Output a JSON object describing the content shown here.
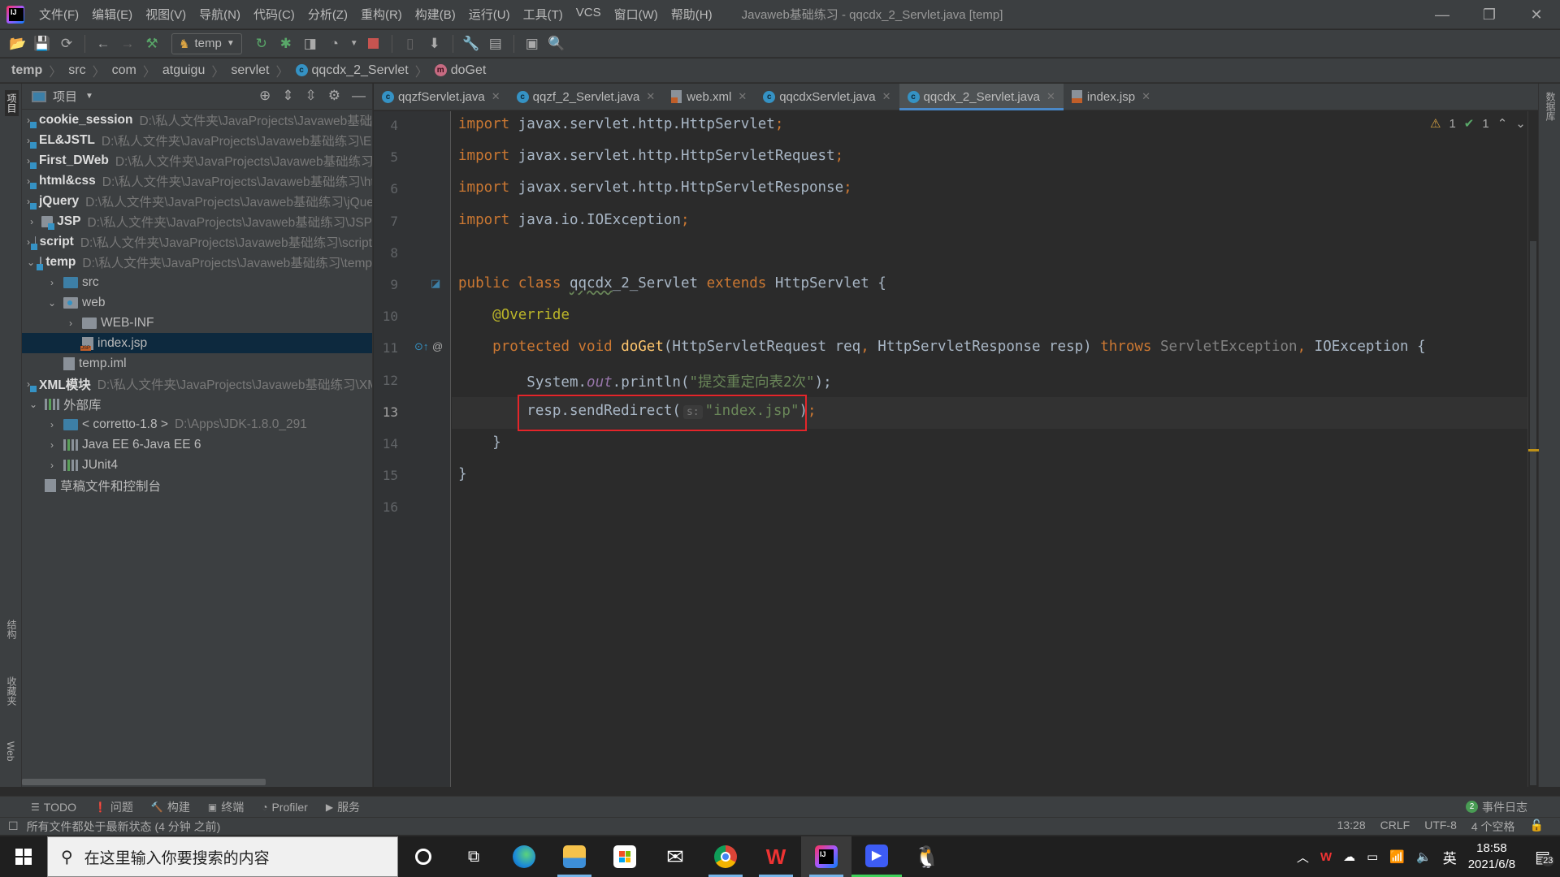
{
  "window": {
    "title": "Javaweb基础练习 - qqcdx_2_Servlet.java [temp]",
    "menu": [
      "文件(F)",
      "编辑(E)",
      "视图(V)",
      "导航(N)",
      "代码(C)",
      "分析(Z)",
      "重构(R)",
      "构建(B)",
      "运行(U)",
      "工具(T)",
      "VCS",
      "窗口(W)",
      "帮助(H)"
    ],
    "controls": {
      "minimize": "—",
      "restore": "❐",
      "close": "✕"
    }
  },
  "toolbar": {
    "run_config": "temp",
    "icons": [
      "open-icon",
      "save-icon",
      "sync-icon",
      "back-icon",
      "forward-icon",
      "build-icon",
      "run-config",
      "rerun-icon",
      "debug-icon",
      "coverage-icon",
      "profile-icon",
      "stop-icon",
      "device-icon",
      "update-icon",
      "settings-icon",
      "project-structure-icon",
      "terminal-icon",
      "search-icon"
    ]
  },
  "breadcrumb": [
    {
      "label": "temp",
      "bold": true
    },
    {
      "label": "src"
    },
    {
      "label": "com"
    },
    {
      "label": "atguigu"
    },
    {
      "label": "servlet"
    },
    {
      "label": "qqcdx_2_Servlet",
      "icon": "class-icon",
      "glyph": "c"
    },
    {
      "label": "doGet",
      "icon": "method-icon",
      "glyph": "m"
    }
  ],
  "left_strip": {
    "project": "项目",
    "structure": "结构",
    "favorites": "收藏夹",
    "web": "Web"
  },
  "right_strip": {
    "database": "数据库"
  },
  "project_panel": {
    "title": "项目",
    "tree": [
      {
        "depth": 0,
        "chev": "›",
        "icon": "module",
        "name": "cookie_session",
        "bold": true,
        "path": "D:\\私人文件夹\\JavaProjects\\Javaweb基础练习\\cookie_session"
      },
      {
        "depth": 0,
        "chev": "›",
        "icon": "module",
        "name": "EL&JSTL",
        "bold": true,
        "path": "D:\\私人文件夹\\JavaProjects\\Javaweb基础练习\\EL&JSTL"
      },
      {
        "depth": 0,
        "chev": "›",
        "icon": "module",
        "name": "First_DWeb",
        "bold": true,
        "path": "D:\\私人文件夹\\JavaProjects\\Javaweb基础练习\\First_DWeb"
      },
      {
        "depth": 0,
        "chev": "›",
        "icon": "module",
        "name": "html&css",
        "bold": true,
        "path": "D:\\私人文件夹\\JavaProjects\\Javaweb基础练习\\html&css"
      },
      {
        "depth": 0,
        "chev": "›",
        "icon": "module",
        "name": "jQuery",
        "bold": true,
        "path": "D:\\私人文件夹\\JavaProjects\\Javaweb基础练习\\jQuery"
      },
      {
        "depth": 0,
        "chev": "›",
        "icon": "module",
        "name": "JSP",
        "bold": true,
        "path": "D:\\私人文件夹\\JavaProjects\\Javaweb基础练习\\JSP"
      },
      {
        "depth": 0,
        "chev": "›",
        "icon": "module",
        "name": "script",
        "bold": true,
        "path": "D:\\私人文件夹\\JavaProjects\\Javaweb基础练习\\script"
      },
      {
        "depth": 0,
        "chev": "⌄",
        "icon": "module",
        "name": "temp",
        "bold": true,
        "path": "D:\\私人文件夹\\JavaProjects\\Javaweb基础练习\\temp"
      },
      {
        "depth": 1,
        "chev": "›",
        "icon": "src",
        "name": "src"
      },
      {
        "depth": 1,
        "chev": "⌄",
        "icon": "web",
        "name": "web"
      },
      {
        "depth": 2,
        "chev": "›",
        "icon": "folder",
        "name": "WEB-INF"
      },
      {
        "depth": 2,
        "chev": "",
        "icon": "jsp",
        "name": "index.jsp",
        "selected": true
      },
      {
        "depth": 1,
        "chev": "",
        "icon": "iml",
        "name": "temp.iml"
      },
      {
        "depth": 0,
        "chev": "›",
        "icon": "module",
        "name": "XML模块",
        "bold": true,
        "path": "D:\\私人文件夹\\JavaProjects\\Javaweb基础练习\\XML模块"
      },
      {
        "depth": 0,
        "chev": "⌄",
        "icon": "libs",
        "name": "外部库"
      },
      {
        "depth": 1,
        "chev": "›",
        "icon": "jdk",
        "name": "< corretto-1.8 >",
        "path": "D:\\Apps\\JDK-1.8.0_291"
      },
      {
        "depth": 1,
        "chev": "›",
        "icon": "lib",
        "name": "Java EE 6-Java EE 6"
      },
      {
        "depth": 1,
        "chev": "›",
        "icon": "lib",
        "name": "JUnit4"
      },
      {
        "depth": 0,
        "chev": "",
        "icon": "scratch",
        "name": "草稿文件和控制台"
      }
    ]
  },
  "tabs": [
    {
      "label": "qqzfServlet.java",
      "icon": "class"
    },
    {
      "label": "qqzf_2_Servlet.java",
      "icon": "class"
    },
    {
      "label": "web.xml",
      "icon": "xml"
    },
    {
      "label": "qqcdxServlet.java",
      "icon": "class"
    },
    {
      "label": "qqcdx_2_Servlet.java",
      "icon": "class",
      "active": true
    },
    {
      "label": "index.jsp",
      "icon": "jsp"
    }
  ],
  "inspections": {
    "warnings": "1",
    "ok": "1"
  },
  "editor": {
    "current_line": 13,
    "lines": [
      {
        "n": "4",
        "tokens": [
          [
            "kw",
            "import "
          ],
          [
            "",
            "javax.servlet.http.HttpServlet"
          ],
          [
            "kw",
            ";"
          ]
        ]
      },
      {
        "n": "5",
        "tokens": [
          [
            "kw",
            "import "
          ],
          [
            "",
            "javax.servlet.http.HttpServletRequest"
          ],
          [
            "kw",
            ";"
          ]
        ]
      },
      {
        "n": "6",
        "tokens": [
          [
            "kw",
            "import "
          ],
          [
            "",
            "javax.servlet.http.HttpServletResponse"
          ],
          [
            "kw",
            ";"
          ]
        ]
      },
      {
        "n": "7",
        "tokens": [
          [
            "kw",
            "import "
          ],
          [
            "",
            "java.io.IOException"
          ],
          [
            "kw",
            ";"
          ]
        ]
      },
      {
        "n": "8",
        "tokens": []
      },
      {
        "n": "9",
        "tokens": [
          [
            "kw",
            "public class "
          ],
          [
            "ul",
            "qqcdx"
          ],
          [
            "",
            "_2_Servlet "
          ],
          [
            "kw",
            "extends "
          ],
          [
            "",
            "HttpServlet {"
          ]
        ]
      },
      {
        "n": "10",
        "tokens": [
          [
            "",
            "    "
          ],
          [
            "ann",
            "@Override"
          ]
        ]
      },
      {
        "n": "11",
        "tokens": [
          [
            "",
            "    "
          ],
          [
            "kw",
            "protected void "
          ],
          [
            "fn",
            "doGet"
          ],
          [
            "",
            "(HttpServletRequest req"
          ],
          [
            "kw",
            ", "
          ],
          [
            "",
            "HttpServletResponse resp) "
          ],
          [
            "kw",
            "throws "
          ],
          [
            "dim",
            "ServletException"
          ],
          [
            "kw",
            ", "
          ],
          [
            "",
            "IOException {"
          ]
        ]
      },
      {
        "n": "12",
        "tokens": [
          [
            "",
            "        System."
          ],
          [
            "ital",
            "out"
          ],
          [
            "",
            ".println("
          ],
          [
            "str",
            "\"提交重定向表2次\""
          ],
          [
            "",
            "); "
          ]
        ]
      },
      {
        "n": "13",
        "tokens": [
          [
            "",
            "        resp.sendRedirect("
          ],
          [
            "hint",
            "s:"
          ],
          [
            "str",
            "\"index.jsp\""
          ],
          [
            "",
            ")"
          ],
          [
            "kw",
            ";"
          ]
        ]
      },
      {
        "n": "14",
        "tokens": [
          [
            "",
            "    }"
          ]
        ]
      },
      {
        "n": "15",
        "tokens": [
          [
            "",
            "}"
          ]
        ]
      },
      {
        "n": "16",
        "tokens": []
      }
    ]
  },
  "tool_windows": [
    {
      "label": "TODO",
      "icon": "list-icon",
      "glyph": "☰"
    },
    {
      "label": "问题",
      "icon": "problems-icon",
      "glyph": "❗"
    },
    {
      "label": "构建",
      "icon": "build-icon",
      "glyph": "🔨"
    },
    {
      "label": "终端",
      "icon": "terminal-icon",
      "glyph": "▣"
    },
    {
      "label": "Profiler",
      "icon": "profiler-icon",
      "glyph": "◔"
    },
    {
      "label": "服务",
      "icon": "services-icon",
      "glyph": "▶"
    }
  ],
  "event_log": {
    "count": "2",
    "label": "事件日志"
  },
  "status": {
    "message": "所有文件都处于最新状态 (4 分钟 之前)",
    "position": "13:28",
    "line_sep": "CRLF",
    "encoding": "UTF-8",
    "indent": "4 个空格"
  },
  "taskbar": {
    "search_placeholder": "在这里输入你要搜索的内容",
    "apps": [
      "cortana",
      "task-view",
      "edge",
      "file-explorer",
      "store",
      "mail",
      "chrome",
      "wps",
      "intellij-idea",
      "video-app",
      "qq"
    ],
    "tray": {
      "ime": "英",
      "time": "18:58",
      "date": "2021/6/8",
      "notifications": "23"
    }
  },
  "colors": {
    "accent": "#4a88c7",
    "highlight_box": "#e5252a",
    "keyword": "#cc7832",
    "string": "#6a8759",
    "annotation": "#bbb529",
    "function": "#ffc66d"
  }
}
